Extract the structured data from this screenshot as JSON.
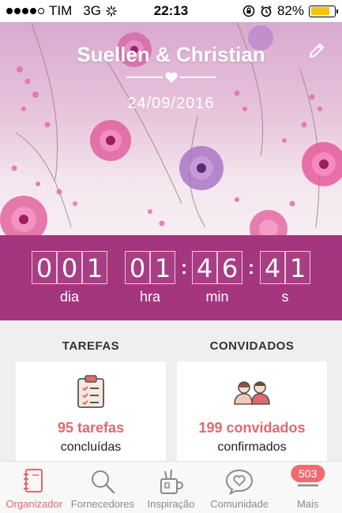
{
  "status_bar": {
    "carrier": "TIM",
    "network": "3G",
    "time": "22:13",
    "battery": "82%"
  },
  "header": {
    "couple_names": "Suellen & Christian",
    "wedding_date": "24/09/2016"
  },
  "countdown": {
    "days": [
      "0",
      "0",
      "1"
    ],
    "hours": [
      "0",
      "1"
    ],
    "minutes": [
      "4",
      "6"
    ],
    "seconds": [
      "4",
      "1"
    ],
    "labels": {
      "days": "dia",
      "hours": "hra",
      "minutes": "min",
      "seconds": "s"
    }
  },
  "cards": {
    "tasks": {
      "title": "TAREFAS",
      "count": "95 tarefas",
      "sub": "concluídas"
    },
    "guests": {
      "title": "CONVIDADOS",
      "count": "199 convidados",
      "sub": "confirmados"
    }
  },
  "tabs": [
    {
      "label": "Organizador",
      "icon": "notebook-icon"
    },
    {
      "label": "Fornecedores",
      "icon": "search-icon"
    },
    {
      "label": "Inspiração",
      "icon": "inspiration-icon"
    },
    {
      "label": "Comunidade",
      "icon": "chat-heart-icon"
    },
    {
      "label": "Mais",
      "icon": "menu-icon",
      "badge": "503"
    }
  ],
  "colors": {
    "accent": "#e0686e",
    "countdown_bg": "#a4357f"
  }
}
